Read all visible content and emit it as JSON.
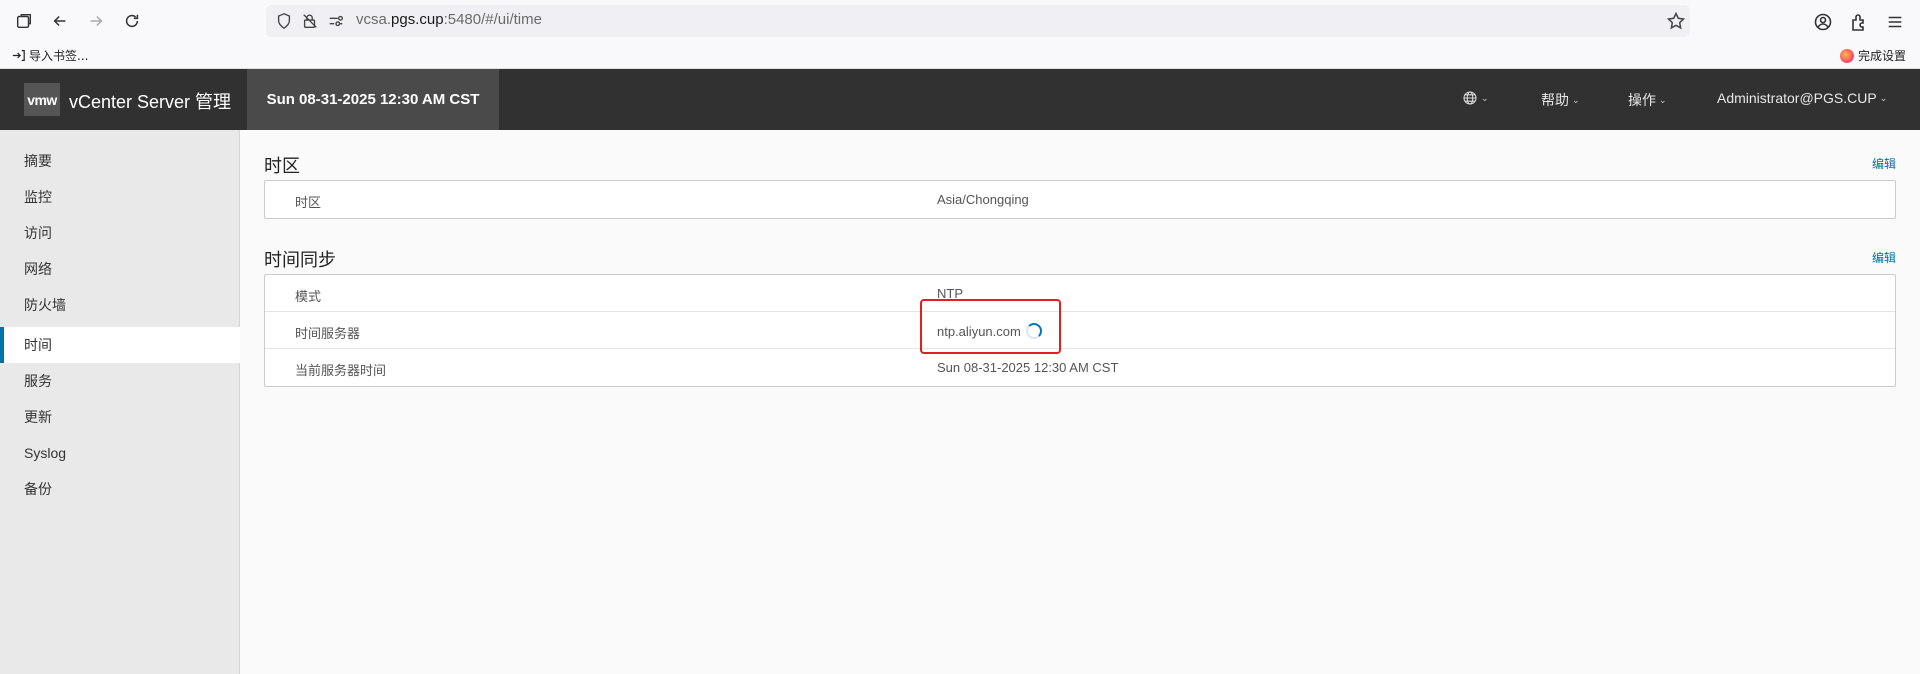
{
  "browser": {
    "url_prefix": "vcsa.",
    "url_host": "pgs.cup",
    "url_suffix": ":5480/#/ui/time"
  },
  "bookmarks": {
    "import_label": "导入书签...",
    "finish_label": "完成设置"
  },
  "header": {
    "logo": "vmw",
    "title": "vCenter Server 管理",
    "datetime": "Sun 08-31-2025 12:30 AM CST",
    "help": "帮助",
    "actions": "操作",
    "user": "Administrator@PGS.CUP"
  },
  "sidebar": {
    "items": [
      {
        "label": "摘要"
      },
      {
        "label": "监控"
      },
      {
        "label": "访问"
      },
      {
        "label": "网络"
      },
      {
        "label": "防火墙"
      },
      {
        "label": "时间"
      },
      {
        "label": "服务"
      },
      {
        "label": "更新"
      },
      {
        "label": "Syslog"
      },
      {
        "label": "备份"
      }
    ],
    "active_index": 5
  },
  "timezone": {
    "title": "时区",
    "edit": "编辑",
    "rows": [
      {
        "label": "时区",
        "value": "Asia/Chongqing"
      }
    ]
  },
  "timesync": {
    "title": "时间同步",
    "edit": "编辑",
    "rows": [
      {
        "label": "模式",
        "value": "NTP"
      },
      {
        "label": "时间服务器",
        "value": "ntp.aliyun.com"
      },
      {
        "label": "当前服务器时间",
        "value": "Sun 08-31-2025 12:30 AM CST"
      }
    ]
  },
  "colors": {
    "header_bg": "#313131",
    "accent": "#0072a3",
    "highlight": "#e02020"
  }
}
